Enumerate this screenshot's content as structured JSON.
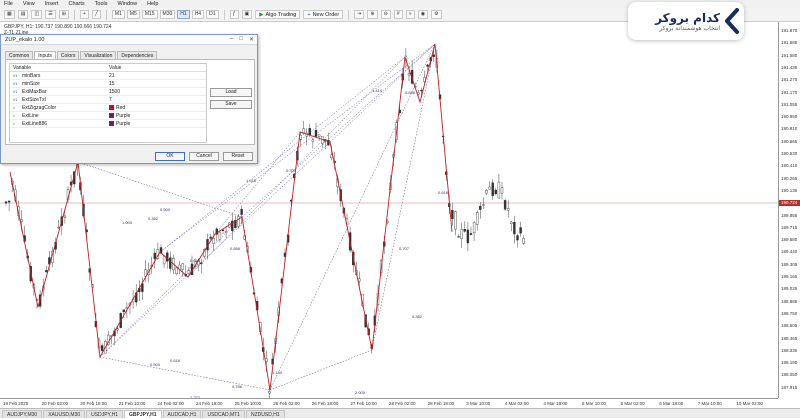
{
  "menu": [
    "File",
    "View",
    "Insert",
    "Charts",
    "Tools",
    "Window",
    "Help"
  ],
  "toolbar": {
    "timeframes": [
      "M1",
      "M5",
      "M15",
      "M30",
      "H1",
      "H4",
      "D1"
    ],
    "active_timeframe": "H1",
    "algo_trading": "Algo Trading",
    "new_order": "New Order"
  },
  "chart": {
    "symbol_line": "GBPJPY, H1: 190.737 190.890 190.666 190.724",
    "indicator_line": "Z-TL ZLine",
    "price_labels": [
      "191.870",
      "191.685",
      "191.580",
      "191.435",
      "191.270",
      "191.170",
      "191.055",
      "190.950",
      "190.810",
      "190.665",
      "190.530",
      "190.410",
      "190.265",
      "190.130",
      "189.990",
      "189.855",
      "189.715",
      "189.580",
      "189.440",
      "189.305",
      "189.165",
      "189.025",
      "188.885",
      "188.750",
      "188.605",
      "188.465",
      "188.330",
      "188.190",
      "188.050",
      "187.915"
    ],
    "current_price": "190.724",
    "time_labels": [
      "19 Feb 2025",
      "20 Feb 02:00",
      "20 Feb 18:00",
      "21 Feb 10:00",
      "24 Feb 02:00",
      "24 Feb 18:00",
      "25 Feb 10:00",
      "26 Feb 02:00",
      "26 Feb 18:00",
      "27 Feb 10:00",
      "28 Feb 02:00",
      "28 Feb 18:00",
      "3 Mar 10:00",
      "4 Mar 02:00",
      "4 Mar 18:00",
      "5 Mar 10:00",
      "6 Mar 02:00",
      "6 Mar 18:00",
      "7 Mar 10:00",
      "10 Mar 02:00"
    ],
    "pattern_labels": [
      "0.500",
      "1.000",
      "0.382",
      "0.618",
      "0.886",
      "1.272",
      "0.786",
      "1.618",
      "0.707",
      "1.130",
      "2.000",
      "0.707",
      "0.382",
      "0.618",
      "1.414",
      "0.886",
      "0.500",
      "0.618"
    ]
  },
  "tabs": [
    "AUDJPY,M30",
    "XAUUSD,M30",
    "USDJPY,H1",
    "GBPJPY,H1",
    "AUDCAD,H1",
    "USDCAD,MT1",
    "NZDUSD,H1"
  ],
  "active_tab": "GBPJPY,H1",
  "dialog": {
    "title": "ZUP_ekalo 1.00",
    "tabs": [
      "Common",
      "Inputs",
      "Colors",
      "Visualization",
      "Dependencies"
    ],
    "active_tab": "Inputs",
    "col_variable": "Variable",
    "col_value": "Value",
    "params": [
      {
        "type": "01",
        "name": "minBars",
        "value": "21"
      },
      {
        "type": "01",
        "name": "minSize",
        "value": "15"
      },
      {
        "type": "01",
        "name": "ExtMaxBar",
        "value": "1500"
      },
      {
        "type": "01",
        "name": "ExtSizeTxt",
        "value": "7"
      },
      {
        "type": "clr",
        "name": "ExtZigzagColor",
        "value": "Red",
        "color": "#c01515"
      },
      {
        "type": "clr",
        "name": "ExtLine",
        "value": "Purple",
        "color": "#6a1a6a"
      },
      {
        "type": "clr",
        "name": "ExtLine886",
        "value": "Purple",
        "color": "#6a1a6a"
      }
    ],
    "load": "Load",
    "save": "Save",
    "ok": "OK",
    "cancel": "Cancel",
    "reset": "Reset"
  },
  "brand": {
    "name": "کدام بروکر",
    "tagline": "انتخاب هوشمندانه بروکر",
    "color": "#1a2b5e"
  }
}
